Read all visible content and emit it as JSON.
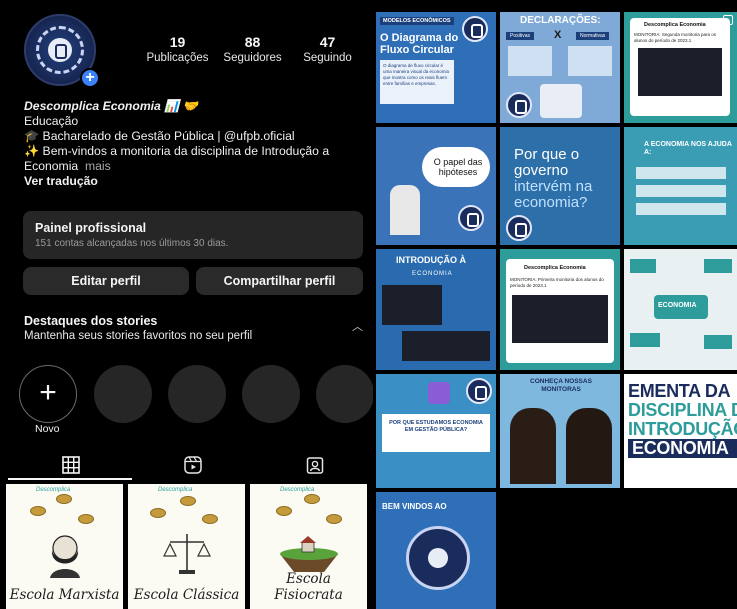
{
  "profile": {
    "stats": [
      {
        "num": "19",
        "label": "Publicações"
      },
      {
        "num": "88",
        "label": "Seguidores"
      },
      {
        "num": "47",
        "label": "Seguindo"
      }
    ],
    "name": "Descomplica Economia 📊 🤝",
    "category": "Educação",
    "bio_line1": "🎓 Bacharelado de Gestão Pública | @ufpb.oficial",
    "bio_line2": "✨ Bem-vindos a monitoria da disciplina de Introdução a",
    "bio_line3": "Economia",
    "more": "mais",
    "translate": "Ver tradução"
  },
  "pro_panel": {
    "title": "Painel profissional",
    "subtitle": "151 contas alcançadas nos últimos 30 dias."
  },
  "buttons": {
    "edit": "Editar perfil",
    "share": "Compartilhar perfil"
  },
  "highlights": {
    "title": "Destaques dos stories",
    "subtitle": "Mantenha seus stories favoritos no seu perfil",
    "new_label": "Novo"
  },
  "thumbs": [
    {
      "label": "Escola Marxista",
      "tiny": "Descomplica"
    },
    {
      "label": "Escola Clássica",
      "tiny": "Descomplica"
    },
    {
      "label": "Escola Fisiocrata",
      "tiny": "Descomplica"
    }
  ],
  "grid": {
    "c1": {
      "tag": "MODELOS ECONÔMICOS",
      "title1": "O Diagrama do",
      "title2": "Fluxo Circular",
      "body": "O diagrama de fluxo circular é uma maneira visual da economia que mostra como os reais fluem entre famílias e empresas."
    },
    "c2": {
      "title": "DECLARAÇÕES:",
      "a": "Positivas",
      "x": "X",
      "b": "Normativas"
    },
    "c3": {
      "name": "Descomplica Economia",
      "body": "MONITORIA: Segunda monitoria para os alunos do período de 2023.1"
    },
    "c4": {
      "text": "O papel das hipóteses"
    },
    "c5": {
      "l1": "Por que o",
      "l2": "governo",
      "l3": "intervém na",
      "l4": "economia?"
    },
    "c6": {
      "title": "A ECONOMIA NOS AJUDA A:"
    },
    "c7": {
      "title": "INTRODUÇÃO À",
      "sub": "ECONOMIA"
    },
    "c8": {
      "name": "Descomplica Economia",
      "body": "MONITORIA: Primeira monitoria dos alunos do período de 2023.1"
    },
    "c9": {
      "title": "ECONOMIA"
    },
    "c10": {
      "text": "POR QUE ESTUDAMOS ECONOMIA EM GESTÃO PÚBLICA?"
    },
    "c11": {
      "title": "CONHEÇA NOSSAS MONITORAS"
    },
    "c12": {
      "l1": "EMENTA DA",
      "l2": "DISCIPLINA D",
      "l3": "INTRODUÇÃO",
      "l4": "ECONOMIA"
    },
    "c13": {
      "title": "BEM VINDOS AO"
    }
  },
  "colors": {
    "accent": "#3b82f6",
    "dark_bg": "#000000",
    "panel_bg": "#262626",
    "navy": "#1a2c5c",
    "post_blue": "#2f6fb8",
    "post_teal": "#2d9c9a"
  }
}
